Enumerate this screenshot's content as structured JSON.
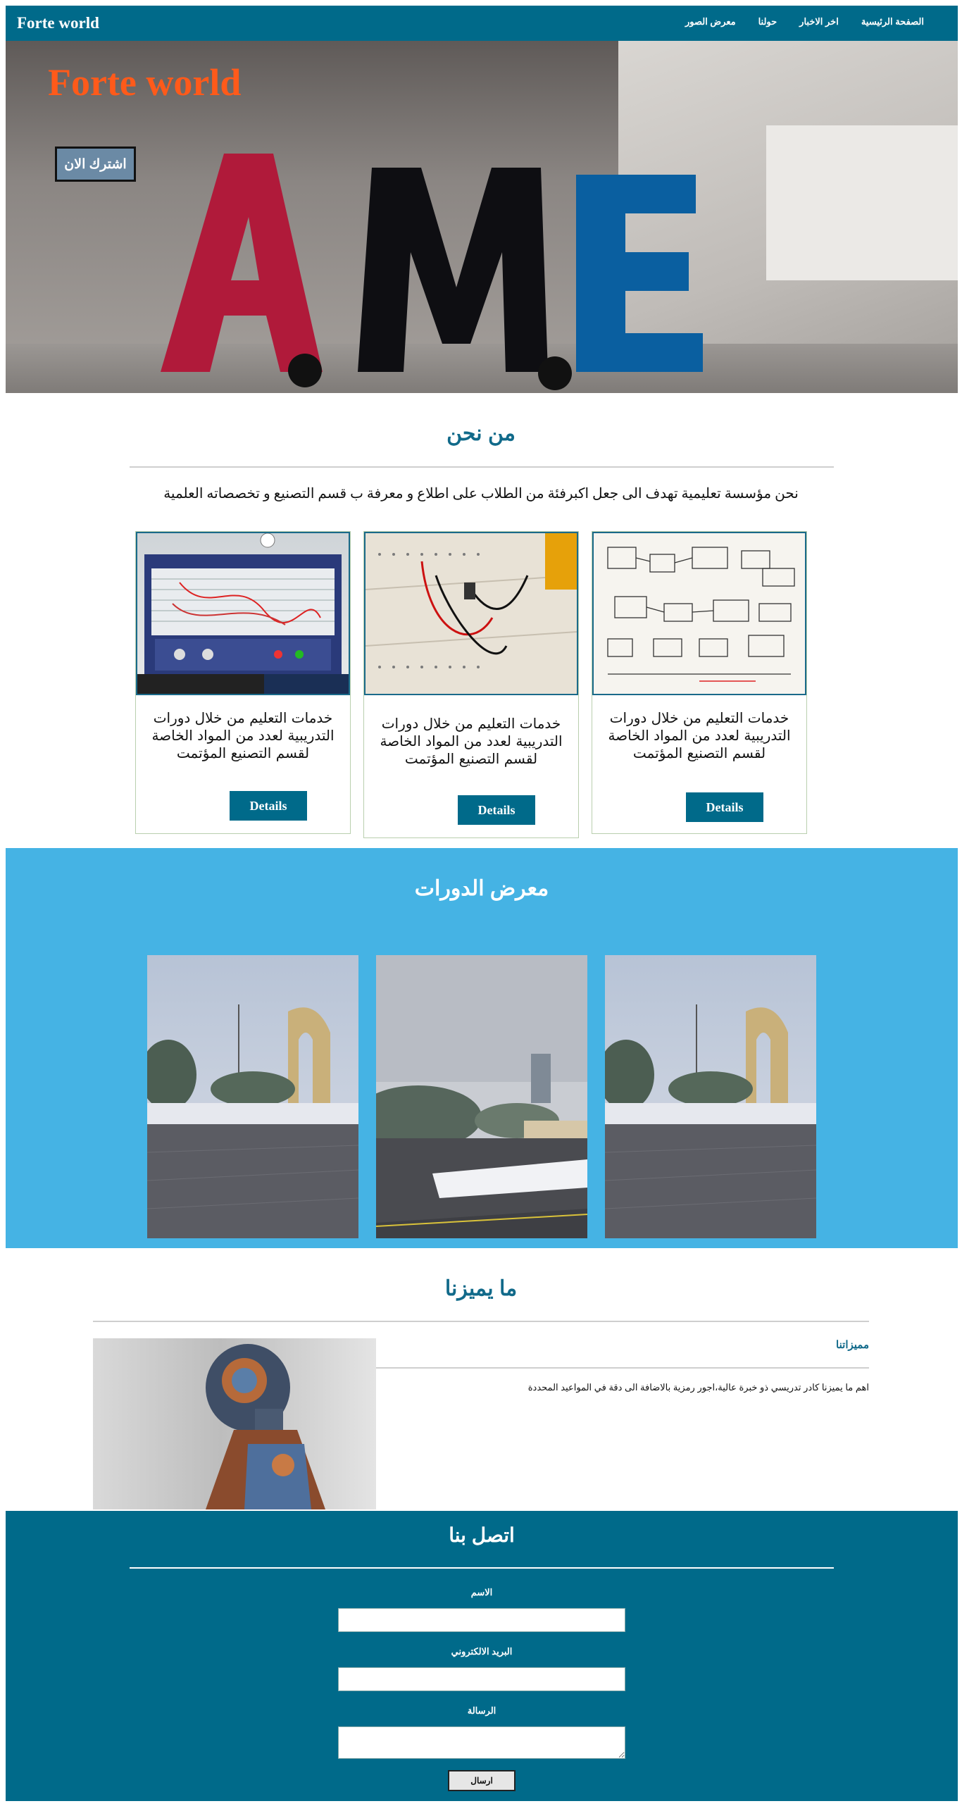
{
  "navbar": {
    "brand": "Forte world",
    "links": [
      "الصفحة الرئيسية",
      "اخر الاخبار",
      "حولنا",
      "معرض الصور"
    ]
  },
  "hero": {
    "title": "Forte world",
    "subscribe_label": "اشترك الان",
    "image_text": "A.M.E"
  },
  "about": {
    "title": "من نحن",
    "text": "نحن مؤسسة تعليمية تهدف الى جعل اكبرفئة من الطلاب على اطلاع و معرفة ب قسم التصنيع و تخصصاته العلمية",
    "cards": [
      {
        "caption": "خدمات التعليم من خلال دورات التدريبية لعدد من المواد الخاصة لقسم التصنيع المؤتمت",
        "button": "Details",
        "image": "training-equipment-photo"
      },
      {
        "caption": "خدمات التعليم من خلال دورات التدريبية لعدد من المواد الخاصة لقسم التصنيع المؤتمت",
        "button": "Details",
        "image": "breadboard-photo"
      },
      {
        "caption": "خدمات التعليم من خلال دورات التدريبية لعدد من المواد الخاصة لقسم التصنيع المؤتمت",
        "button": "Details",
        "image": "whiteboard-diagram-photo"
      }
    ]
  },
  "gallery": {
    "title": "معرض الدورات",
    "images": [
      "monument-snow-photo",
      "campus-snow-photo",
      "monument-snow-photo"
    ]
  },
  "features": {
    "title": "ما يميزنا",
    "heading": "مميزاتنا",
    "text": "اهم ما يميزنا كادر تدريسي ذو خبرة عالية،اجور رمزية بالاضافة الى دقة في المواعيد المحددة",
    "image": "robot-illustration"
  },
  "contact": {
    "title": "اتصل بنا",
    "name_label": "الاسم",
    "email_label": "البريد الالكتروني",
    "message_label": "الرسالة",
    "submit_label": "ارسال"
  },
  "colors": {
    "primary": "#006a8a",
    "gallery_bg": "#45b3e4",
    "hero_title": "#ff5a1a"
  }
}
